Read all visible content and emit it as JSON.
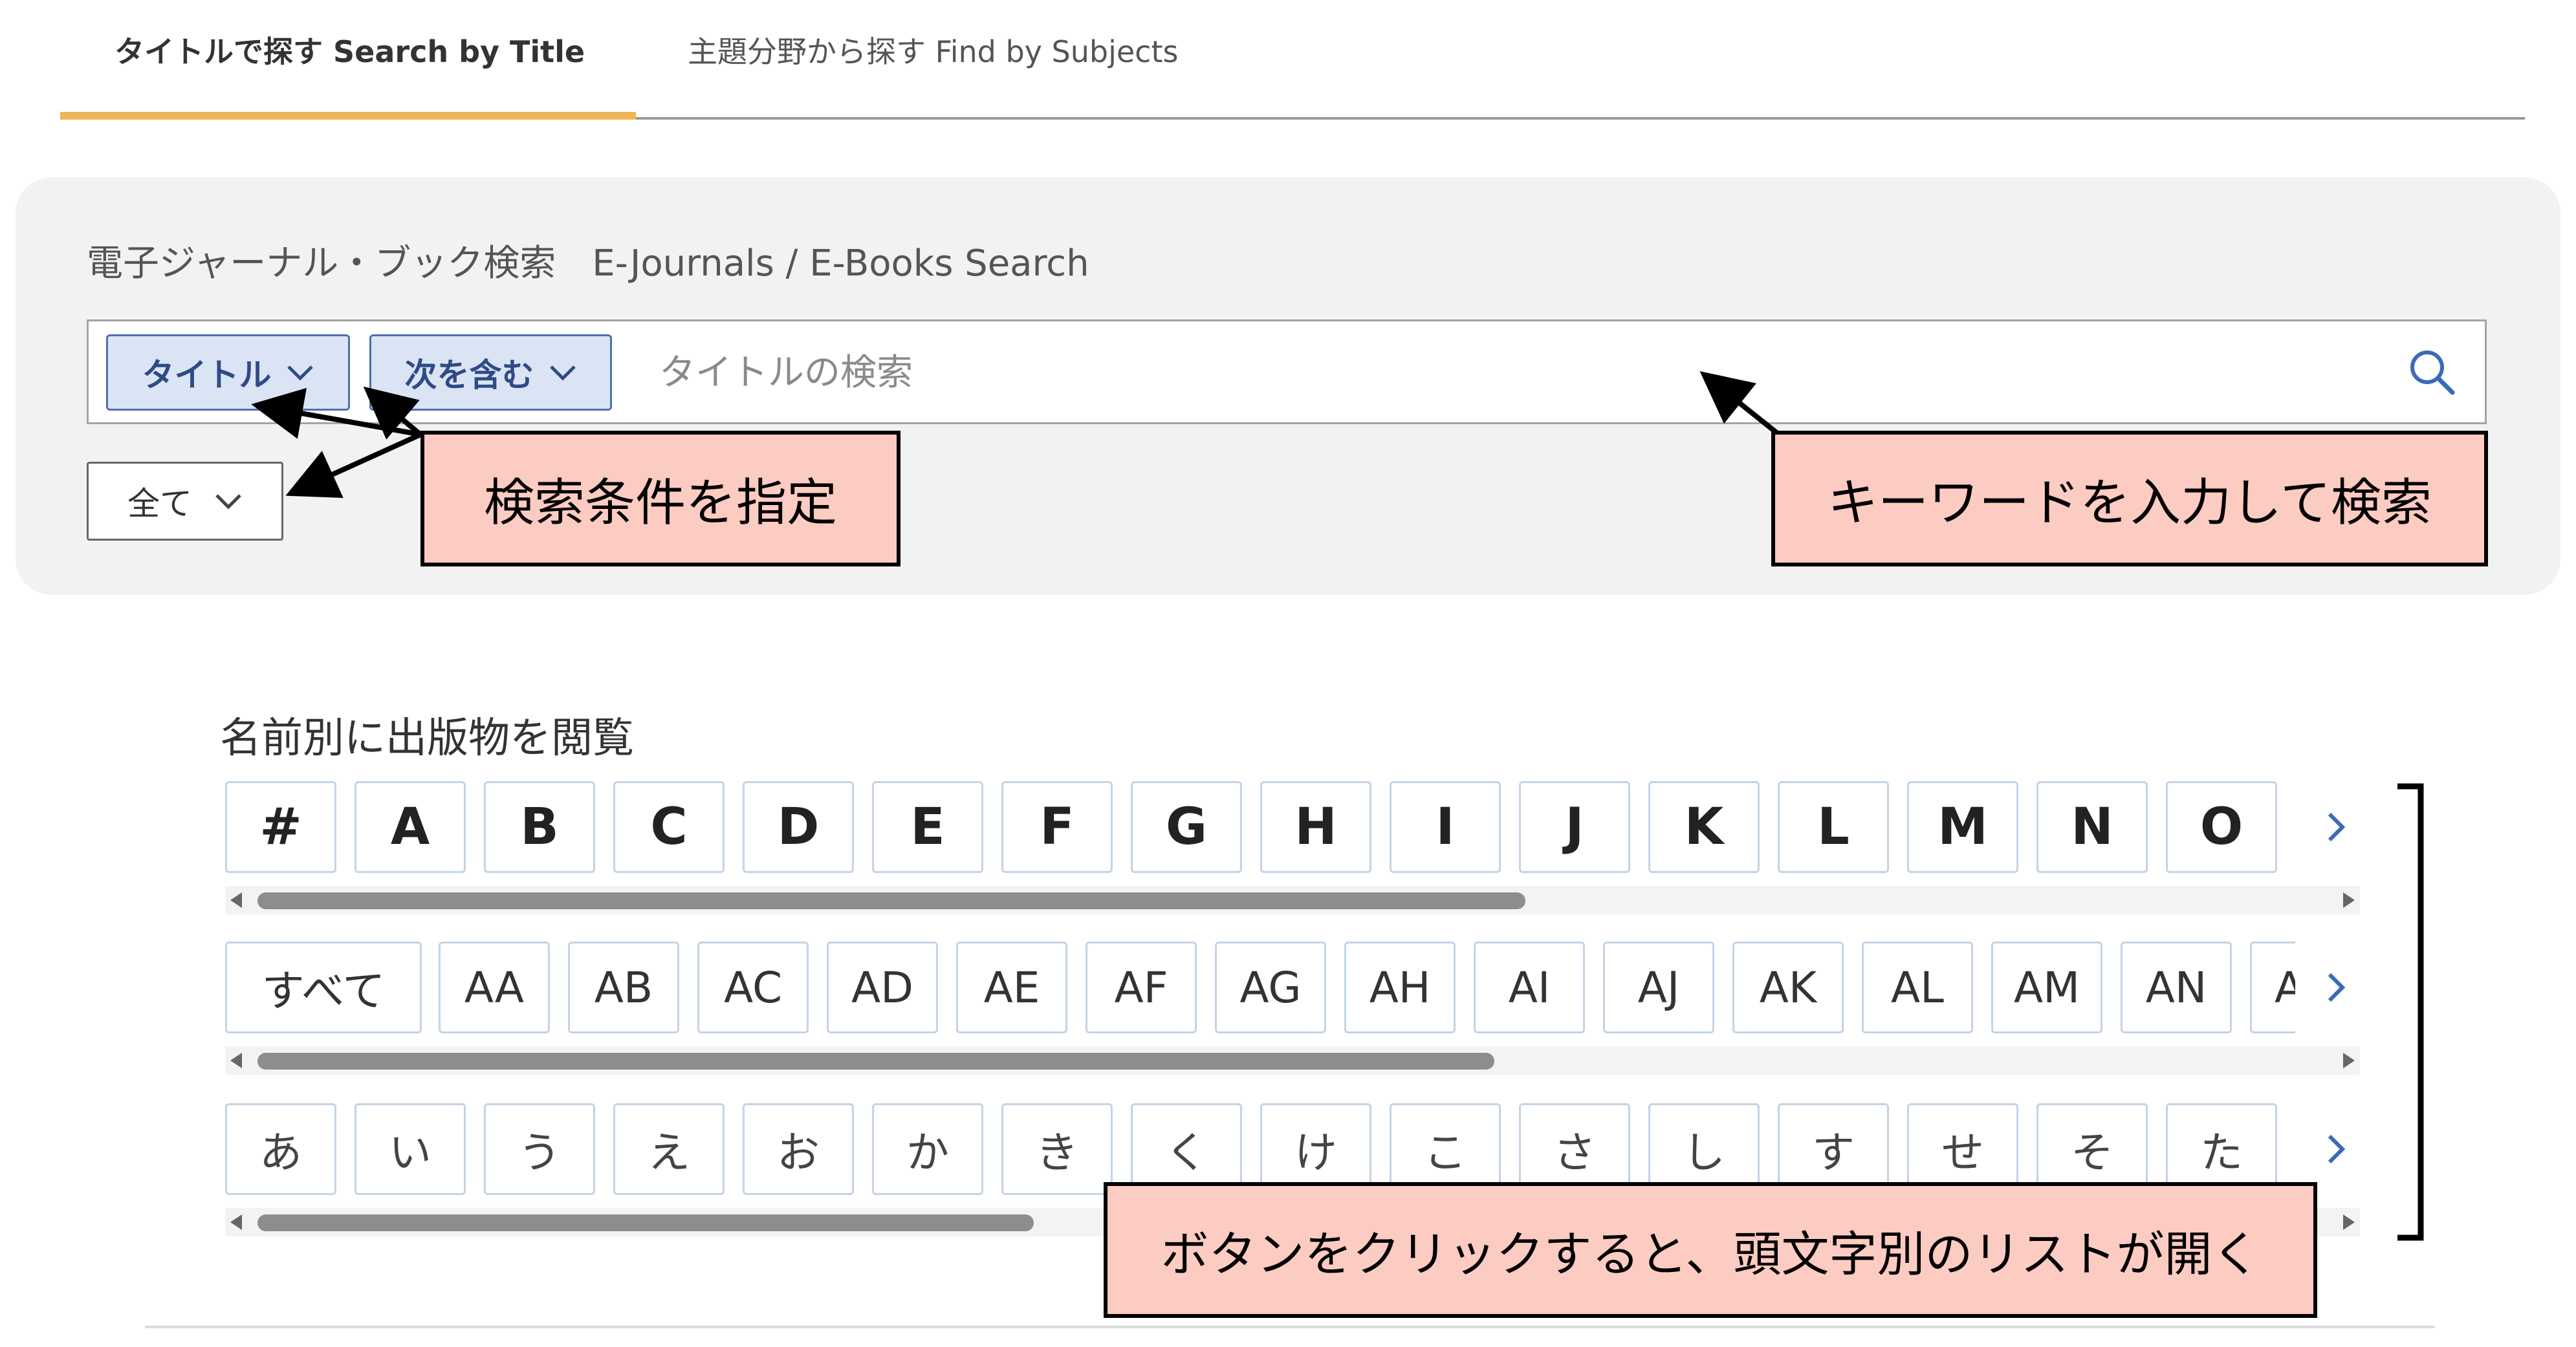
{
  "tabs": [
    {
      "label": "タイトルで探す Search by Title",
      "active": true
    },
    {
      "label": "主題分野から探す Find by Subjects",
      "active": false
    }
  ],
  "colors": {
    "tab_active_underline": "#f0b556",
    "dropdown_accent": "#4d6fb4",
    "callout_fill": "#fccbc1"
  },
  "search": {
    "heading": "電子ジャーナル・ブック検索　E-Journals / E-Books Search",
    "field_dropdown": "タイトル",
    "match_dropdown": "次を含む",
    "placeholder": "タイトルの検索",
    "value": "",
    "type_dropdown": "全て",
    "icons": {
      "search": "search-icon",
      "dropdown": "chevron-down-icon"
    }
  },
  "browse": {
    "heading": "名前別に出版物を閲覧",
    "row_alpha": [
      "#",
      "A",
      "B",
      "C",
      "D",
      "E",
      "F",
      "G",
      "H",
      "I",
      "J",
      "K",
      "L",
      "M",
      "N",
      "O"
    ],
    "row_double": [
      "すべて",
      "AA",
      "AB",
      "AC",
      "AD",
      "AE",
      "AF",
      "AG",
      "AH",
      "AI",
      "AJ",
      "AK",
      "AL",
      "AM",
      "AN",
      "AO"
    ],
    "row_kana": [
      "あ",
      "い",
      "う",
      "え",
      "お",
      "か",
      "き",
      "く",
      "け",
      "こ",
      "さ",
      "し",
      "す",
      "せ",
      "そ",
      "た"
    ],
    "next_icon": "chevron-right-icon"
  },
  "annotations": {
    "conditions": "検索条件を指定",
    "keyword": "キーワードを入力して検索",
    "buttons": "ボタンをクリックすると、頭文字別のリストが開く"
  }
}
